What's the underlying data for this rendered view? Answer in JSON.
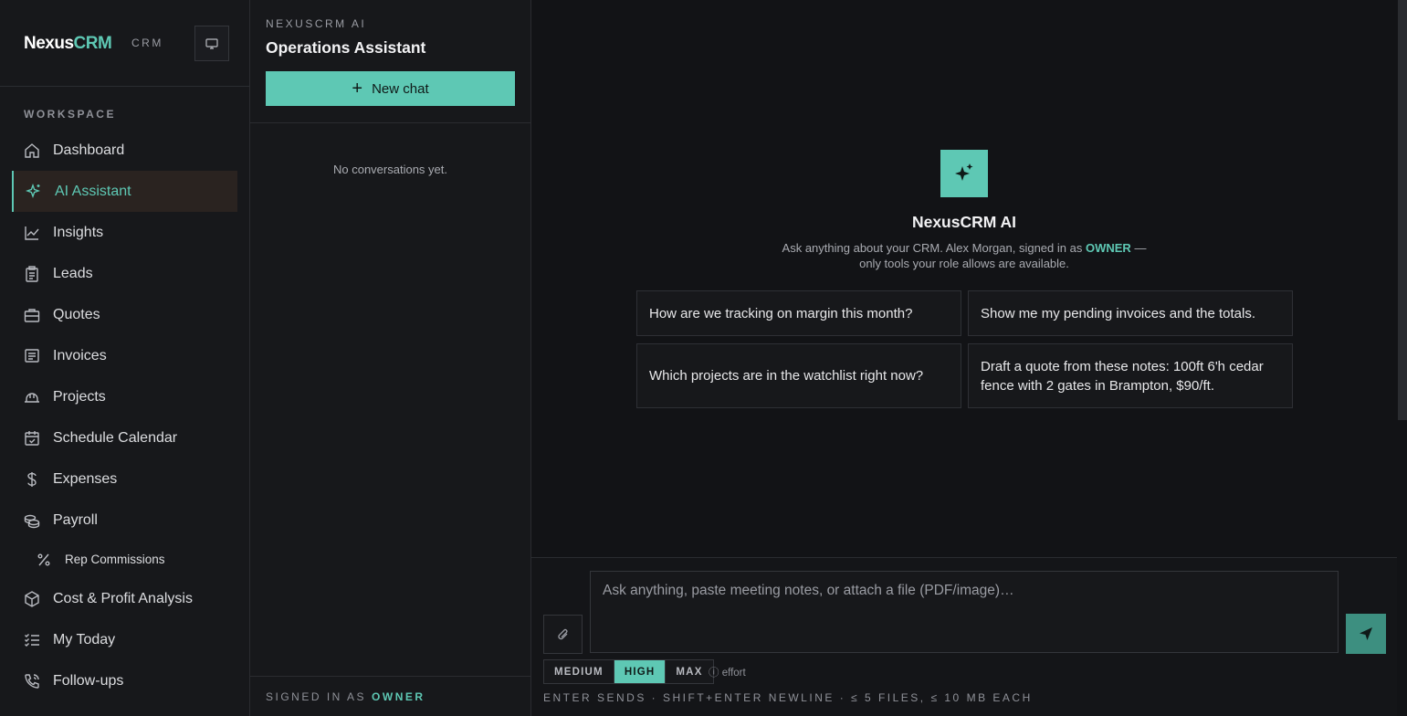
{
  "brand": {
    "name_part1": "Nexus",
    "name_part2": "CRM",
    "tag": "CRM"
  },
  "sidebar": {
    "section_label": "WORKSPACE",
    "items": [
      {
        "label": "Dashboard",
        "icon": "home-icon"
      },
      {
        "label": "AI Assistant",
        "icon": "sparkle-icon",
        "active": true
      },
      {
        "label": "Insights",
        "icon": "chart-line-icon"
      },
      {
        "label": "Leads",
        "icon": "clipboard-icon"
      },
      {
        "label": "Quotes",
        "icon": "briefcase-icon"
      },
      {
        "label": "Invoices",
        "icon": "receipt-icon"
      },
      {
        "label": "Projects",
        "icon": "hardhat-icon"
      },
      {
        "label": "Schedule Calendar",
        "icon": "calendar-icon"
      },
      {
        "label": "Expenses",
        "icon": "dollar-icon"
      },
      {
        "label": "Payroll",
        "icon": "coins-icon"
      },
      {
        "label": "Rep Commissions",
        "icon": "percent-icon",
        "sub": true
      },
      {
        "label": "Cost & Profit Analysis",
        "icon": "box-icon"
      },
      {
        "label": "My Today",
        "icon": "checklist-icon"
      },
      {
        "label": "Follow-ups",
        "icon": "phone-icon"
      }
    ]
  },
  "conversations": {
    "eyebrow": "NEXUSCRM AI",
    "title": "Operations Assistant",
    "new_chat_label": "New chat",
    "empty_text": "No conversations yet.",
    "footer_prefix": "SIGNED IN AS",
    "footer_role": "OWNER"
  },
  "hero": {
    "title": "NexusCRM AI",
    "subtitle_before": "Ask anything about your CRM. Alex Morgan, signed in as",
    "subtitle_role": "OWNER",
    "subtitle_after": "— only tools your role allows are available."
  },
  "suggestions": [
    "How are we tracking on margin this month?",
    "Show me my pending invoices and the totals.",
    "Which projects are in the watchlist right now?",
    "Draft a quote from these notes: 100ft 6'h cedar fence with 2 gates in Brampton, $90/ft."
  ],
  "composer": {
    "placeholder": "Ask anything, paste meeting notes, or attach a file (PDF/image)…",
    "effort_options": [
      "MEDIUM",
      "HIGH",
      "MAX"
    ],
    "effort_selected": "HIGH",
    "effort_note": "ⓘ effort",
    "hint": "ENTER SENDS · SHIFT+ENTER NEWLINE · ≤ 5 FILES, ≤ 10 MB EACH"
  },
  "colors": {
    "accent": "#5ec8b4",
    "background": "#121316",
    "panel": "#17181b"
  }
}
